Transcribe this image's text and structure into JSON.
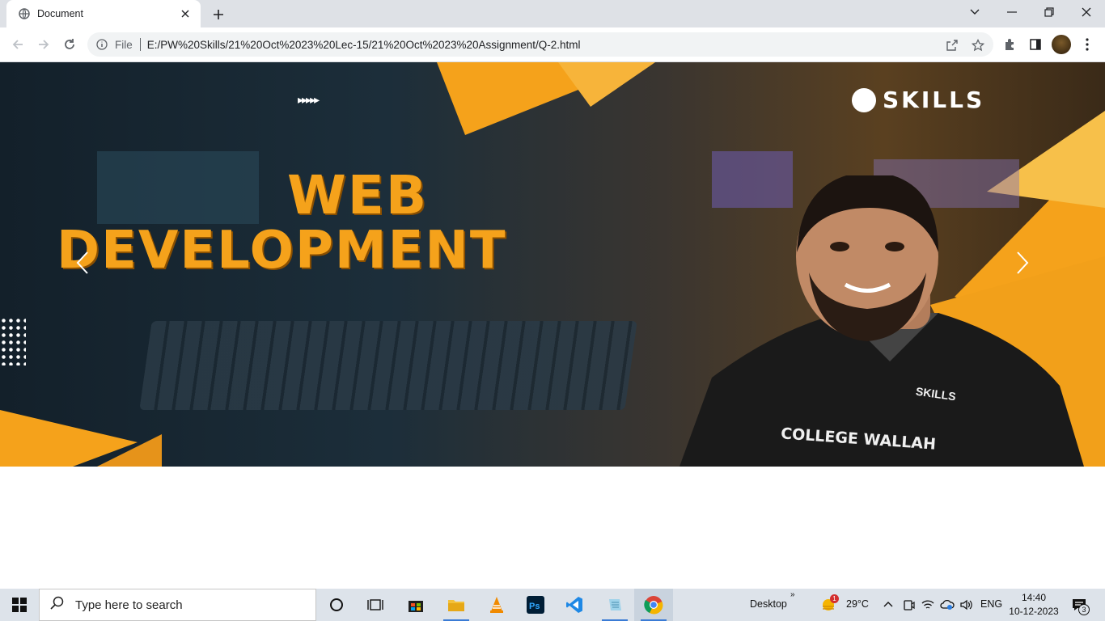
{
  "browser": {
    "tab_title": "Document",
    "scheme_label": "File",
    "url": "E:/PW%20Skills/21%20Oct%2023%20Lec-15/21%20Oct%2023%20Assignment/Q-2.html"
  },
  "hero": {
    "headline_line1": "WEB",
    "headline_line2": "DEVELOPMENT",
    "brand": "SKILLS",
    "shirt_text": "COLLEGE WALLAH",
    "shirt_logo": "SKILLS",
    "prev_icon": "chevron-left-icon",
    "next_icon": "chevron-right-icon"
  },
  "taskbar": {
    "search_placeholder": "Type here to search",
    "desktop_label": "Desktop",
    "weather_temp": "29°C",
    "weather_alert": "1",
    "language": "ENG",
    "time": "14:40",
    "date": "10-12-2023",
    "notification_count": "3"
  },
  "colors": {
    "accent_orange": "#f5a21b",
    "taskbar_bg": "#dde3ea",
    "tabstrip_bg": "#dee1e6"
  }
}
